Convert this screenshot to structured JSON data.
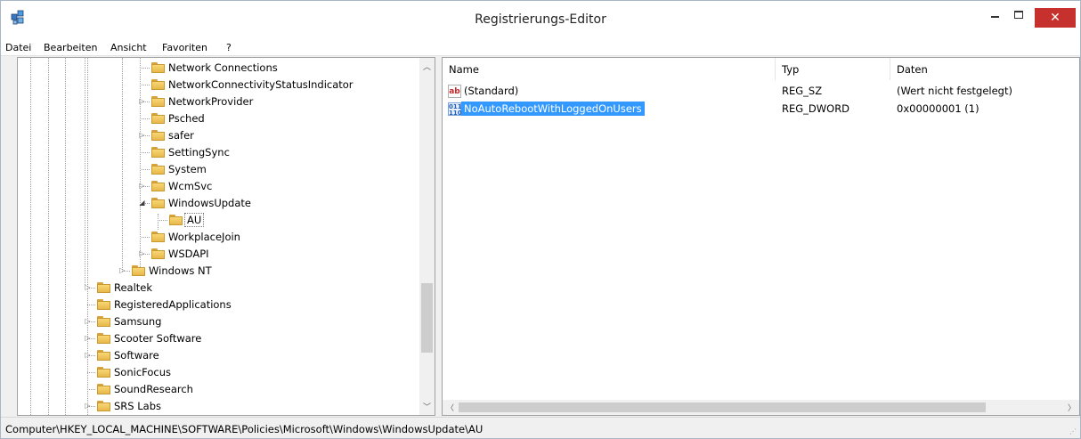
{
  "window": {
    "title": "Registrierungs-Editor",
    "close_glyph": "✕"
  },
  "menu": [
    {
      "label": "Datei"
    },
    {
      "label": "Bearbeiten"
    },
    {
      "label": "Ansicht"
    },
    {
      "label": "Favoriten"
    },
    {
      "label": "?"
    }
  ],
  "tree": {
    "items": [
      {
        "label": "Network Connections",
        "expandable": false
      },
      {
        "label": "NetworkConnectivityStatusIndicator",
        "expandable": false
      },
      {
        "label": "NetworkProvider",
        "expandable": true
      },
      {
        "label": "Psched",
        "expandable": false
      },
      {
        "label": "safer",
        "expandable": true
      },
      {
        "label": "SettingSync",
        "expandable": false
      },
      {
        "label": "System",
        "expandable": false
      },
      {
        "label": "WcmSvc",
        "expandable": true
      },
      {
        "label": "WindowsUpdate",
        "expandable": true,
        "expanded": true
      },
      {
        "label": "AU",
        "expandable": false,
        "selected": true
      },
      {
        "label": "WorkplaceJoin",
        "expandable": false
      },
      {
        "label": "WSDAPI",
        "expandable": true
      },
      {
        "label": "Windows NT",
        "expandable": true
      },
      {
        "label": "Realtek",
        "expandable": true
      },
      {
        "label": "RegisteredApplications",
        "expandable": false
      },
      {
        "label": "Samsung",
        "expandable": true
      },
      {
        "label": "Scooter Software",
        "expandable": true
      },
      {
        "label": "Software",
        "expandable": true
      },
      {
        "label": "SonicFocus",
        "expandable": false
      },
      {
        "label": "SoundResearch",
        "expandable": false
      },
      {
        "label": "SRS Labs",
        "expandable": true
      }
    ]
  },
  "list": {
    "columns": [
      "Name",
      "Typ",
      "Daten"
    ],
    "rows": [
      {
        "icon": "string-value-icon",
        "icon_text": "ab",
        "name": "(Standard)",
        "type": "REG_SZ",
        "data": "(Wert nicht festgelegt)",
        "selected": false
      },
      {
        "icon": "dword-value-icon",
        "icon_text": "011\n110",
        "name": "NoAutoRebootWithLoggedOnUsers",
        "type": "REG_DWORD",
        "data": "0x00000001 (1)",
        "selected": true
      }
    ]
  },
  "status": {
    "path": "Computer\\HKEY_LOCAL_MACHINE\\SOFTWARE\\Policies\\Microsoft\\Windows\\WindowsUpdate\\AU"
  },
  "colors": {
    "selection": "#3399ff",
    "close_button": "#c7312d",
    "folder": "#f8d775"
  }
}
